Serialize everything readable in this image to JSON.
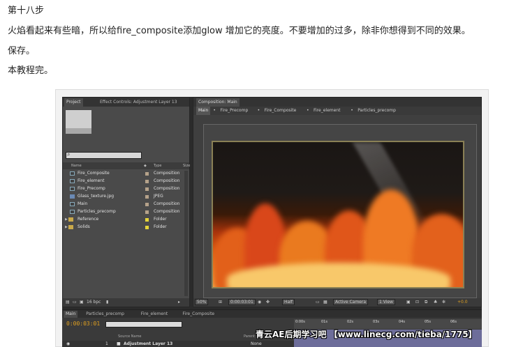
{
  "article": {
    "step_title": "第十八步",
    "instruction": "火焰看起来有些暗，所以给fire_composite添加glow 增加它的亮度。不要增加的过多，除非你想得到不同的效果。",
    "save": "保存。",
    "end": "本教程完。"
  },
  "ae": {
    "project_panel": {
      "tab_project": "Project",
      "tab_effect_controls": "Effect Controls: Adjustment Layer 13",
      "col_name": "Name",
      "col_type": "Type",
      "col_size": "Size",
      "items": [
        {
          "name": "Fire_Composite",
          "type": "Composition",
          "kind": "comp"
        },
        {
          "name": "Fire_element",
          "type": "Composition",
          "kind": "comp"
        },
        {
          "name": "Fire_Precomp",
          "type": "Composition",
          "kind": "comp"
        },
        {
          "name": "Glass_texture.jpg",
          "type": "JPEG",
          "kind": "jpeg"
        },
        {
          "name": "Main",
          "type": "Composition",
          "kind": "comp"
        },
        {
          "name": "Particles_precomp",
          "type": "Composition",
          "kind": "comp"
        },
        {
          "name": "Reference",
          "type": "Folder",
          "kind": "folder"
        },
        {
          "name": "Solids",
          "type": "Folder",
          "kind": "folder"
        }
      ],
      "bpc": "16 bpc"
    },
    "comp_panel": {
      "tab": "Composition: Main",
      "crumbs": [
        "Main",
        "Fire_Precomp",
        "Fire_Composite",
        "Fire_element",
        "Particles_precomp"
      ],
      "zoom": "50%",
      "timecode": "0:00:03:01",
      "resolution": "Half",
      "camera": "Active Camera",
      "view": "1 View",
      "exposure": "+0.0"
    },
    "timeline": {
      "tabs": [
        "Main",
        "Particles_precomp",
        "Fire_element",
        "Fire_Composite"
      ],
      "timecode": "0:00:03:01",
      "ruler": [
        "0:00s",
        "01s",
        "02s",
        "03s",
        "04s",
        "05s",
        "06s"
      ],
      "col_source": "Source Name",
      "col_parent": "Parent",
      "layer_index": "1",
      "layer_name": "Adjustment Layer 13",
      "parent_value": "None"
    }
  },
  "watermark": "青云AE后期学习吧 【www.linecg.com/tieba/1775】"
}
